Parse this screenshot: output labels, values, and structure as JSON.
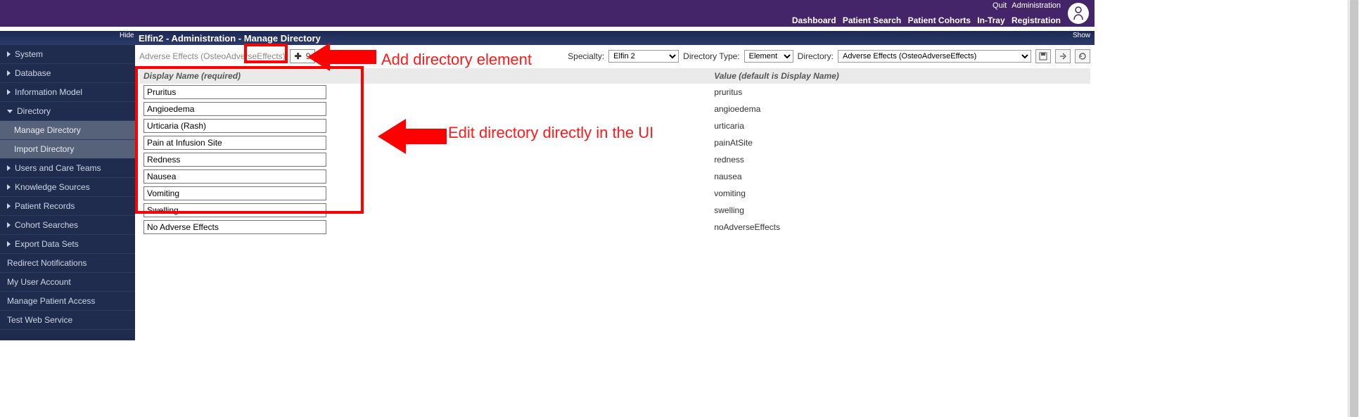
{
  "header": {
    "top_links": {
      "quit": "Quit",
      "administration": "Administration"
    },
    "nav_links": {
      "dashboard": "Dashboard",
      "patient_search": "Patient Search",
      "patient_cohorts": "Patient Cohorts",
      "in_tray": "In-Tray",
      "registration": "Registration"
    }
  },
  "subheader": {
    "hide": "Hide",
    "show": "Show",
    "title": "Elfin2 - Administration - Manage Directory"
  },
  "sidebar": {
    "items": [
      {
        "label": "System",
        "expandable": true
      },
      {
        "label": "Database",
        "expandable": true
      },
      {
        "label": "Information Model",
        "expandable": true
      },
      {
        "label": "Directory",
        "expandable": true,
        "expanded": true,
        "children": [
          {
            "label": "Manage Directory"
          },
          {
            "label": "Import Directory"
          }
        ]
      },
      {
        "label": "Users and Care Teams",
        "expandable": true
      },
      {
        "label": "Knowledge Sources",
        "expandable": true
      },
      {
        "label": "Patient Records",
        "expandable": true
      },
      {
        "label": "Cohort Searches",
        "expandable": true
      },
      {
        "label": "Export Data Sets",
        "expandable": true
      },
      {
        "label": "Redirect Notifications",
        "expandable": false
      },
      {
        "label": "My User Account",
        "expandable": false
      },
      {
        "label": "Manage Patient Access",
        "expandable": false
      },
      {
        "label": "Test Web Service",
        "expandable": false
      }
    ]
  },
  "toolbar": {
    "dir_label": "Adverse Effects (OsteoAdverseEffects)",
    "count": "9",
    "specialty_label": "Specialty:",
    "specialty_value": "Elfin 2",
    "dirtype_label": "Directory Type:",
    "dirtype_value": "Element",
    "directory_label": "Directory:",
    "directory_value": "Adverse Effects (OsteoAdverseEffects)"
  },
  "table": {
    "header_display": "Display Name (required)",
    "header_value": "Value (default is Display Name)",
    "rows": [
      {
        "display": "Pruritus",
        "value": "pruritus"
      },
      {
        "display": "Angioedema",
        "value": "angioedema"
      },
      {
        "display": "Urticaria (Rash)",
        "value": "urticaria"
      },
      {
        "display": "Pain at Infusion Site",
        "value": "painAtSite"
      },
      {
        "display": "Redness",
        "value": "redness"
      },
      {
        "display": "Nausea",
        "value": "nausea"
      },
      {
        "display": "Vomiting",
        "value": "vomiting"
      },
      {
        "display": "Swelling",
        "value": "swelling"
      },
      {
        "display": "No Adverse Effects",
        "value": "noAdverseEffects"
      }
    ]
  },
  "annotations": {
    "add_label": "Add directory element",
    "edit_label": "Edit directory directly in the UI"
  }
}
